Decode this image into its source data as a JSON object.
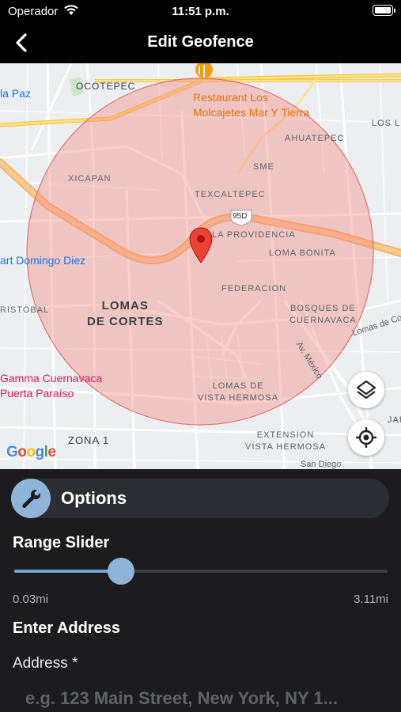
{
  "status_bar": {
    "carrier": "Operador",
    "time": "11:51 p.m.",
    "battery_level": 1.0
  },
  "nav": {
    "title": "Edit Geofence",
    "back_icon": "chevron-left-icon"
  },
  "map": {
    "labels": {
      "ocotepec": "OCOTEPEC",
      "la_paz": "la Paz",
      "restaurant": "Restaurant Los\nMolcajetes Mar Y Tierra",
      "los": "LOS L",
      "ahuatepec": "AHUATEPEC",
      "sme": "SME",
      "xicapan": "XICAPAN",
      "texcaltepec": "TEXCALTEPEC",
      "route_95d": "95D",
      "la_providencia": "LA PROVIDENCIA",
      "loma_bonita": "LOMA BONITA",
      "domingo_diez": "art Domingo Diez",
      "federacion": "FEDERACION",
      "cristobal": "RISTOBAL",
      "lomas_de_cortes": "LOMAS\nDE CORTES",
      "bosques": "BOSQUES DE\nCUERNAVACA",
      "lomas_de_co": "Lomas de Co",
      "av_mexico": "Av. México",
      "gamma": "Gamma Cuernavaca\nPuerta Paraíso",
      "lomas_vista_hermosa": "LOMAS DE\nVISTA HERMOSA",
      "jardin": "JARDIN",
      "zona_1": "ZONA 1",
      "extension": "EXTENSION\nVISTA HERMOSA",
      "san_diego": "San Diego",
      "google": "Google"
    },
    "geofence_color": "#f28b82",
    "marker_color": "#ea4335",
    "layers_icon": "layers-icon",
    "locate_icon": "my-location-icon"
  },
  "options": {
    "icon": "wrench-icon",
    "label": "Options",
    "range_slider_label": "Range Slider",
    "range_min": "0.03mi",
    "range_max": "3.11mi",
    "range_value_fraction": 0.285,
    "enter_address_label": "Enter Address",
    "address_label": "Address *",
    "address_placeholder": "e.g. 123 Main Street, New York, NY 1...",
    "address_value": ""
  },
  "colors": {
    "accent": "#8fb4d9",
    "panel_bg": "#1c1c1e",
    "bar_bg": "#2a2d31"
  }
}
